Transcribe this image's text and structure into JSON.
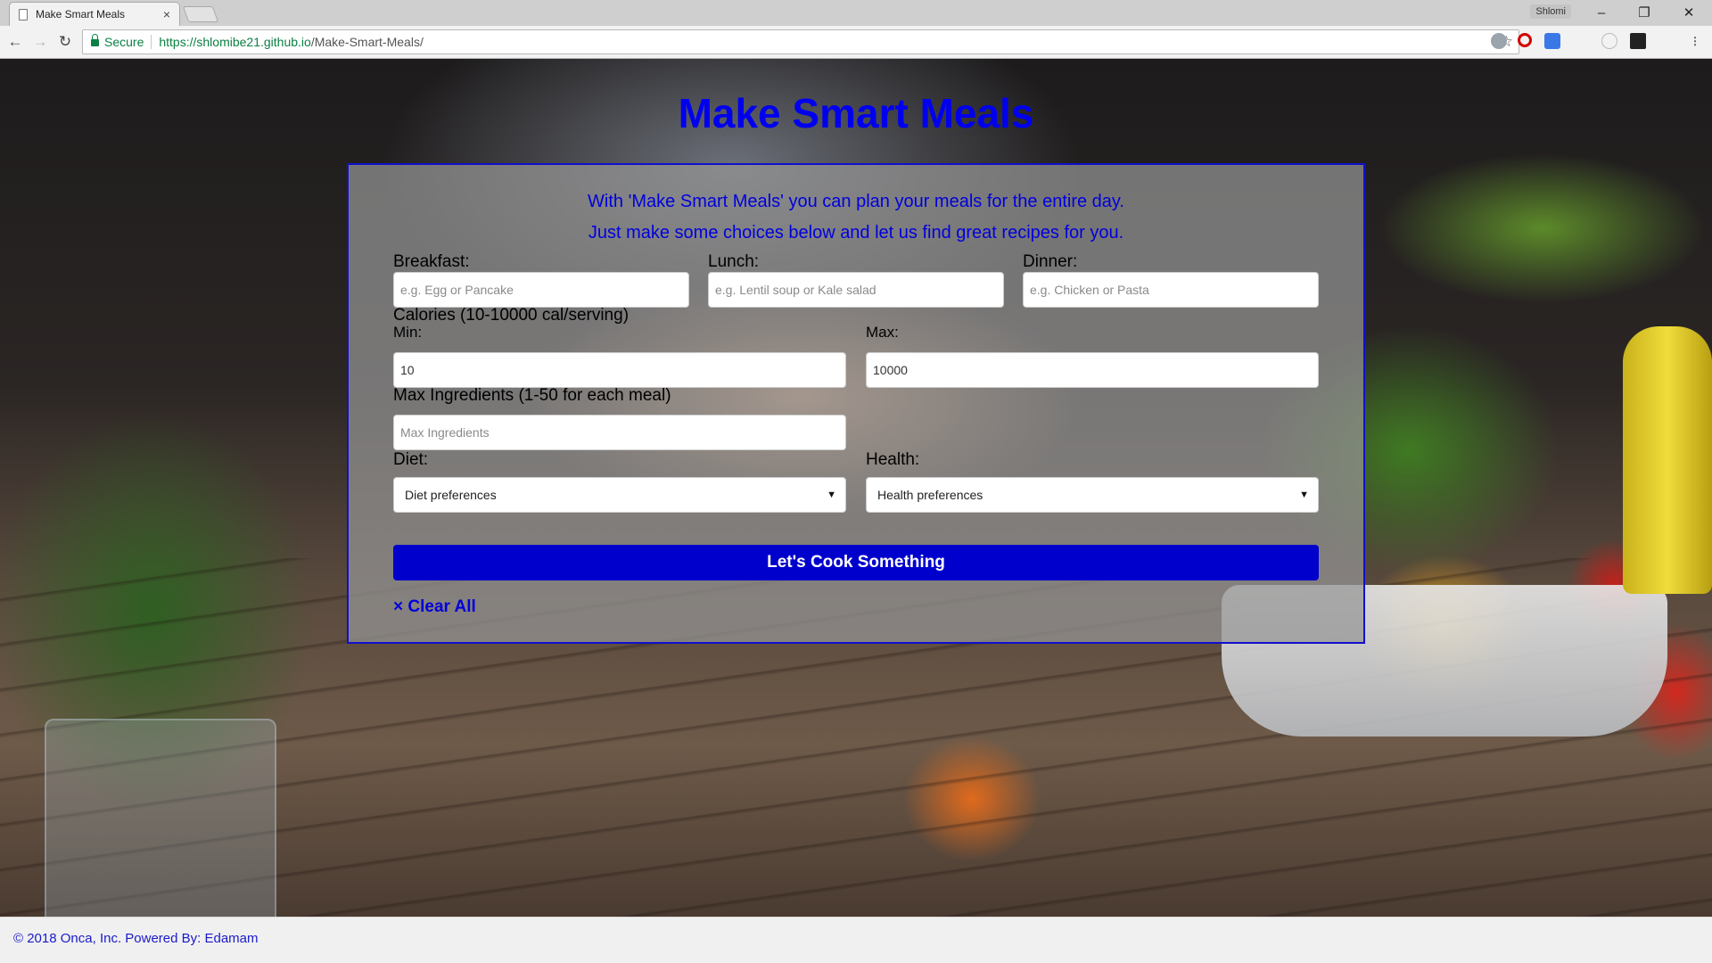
{
  "browser": {
    "tab_title": "Make Smart Meals",
    "tab_close": "×",
    "profile": "Shlomi",
    "window_controls": {
      "minimize": "–",
      "maximize": "❐",
      "close": "✕"
    },
    "nav": {
      "back": "←",
      "forward": "→",
      "reload": "↻"
    },
    "secure_label": "Secure",
    "url_host": "https://shlomibe21.github.io",
    "url_path": "/Make-Smart-Meals/",
    "bookmark_star": "☆"
  },
  "page": {
    "title": "Make Smart Meals",
    "intro_line1": "With 'Make Smart Meals' you can plan your meals for the entire day.",
    "intro_line2": "Just make some choices below and let us find great recipes for you.",
    "meals": {
      "breakfast": {
        "label": "Breakfast:",
        "placeholder": "e.g. Egg or Pancake",
        "value": ""
      },
      "lunch": {
        "label": "Lunch:",
        "placeholder": "e.g. Lentil soup or Kale salad",
        "value": ""
      },
      "dinner": {
        "label": "Dinner:",
        "placeholder": "e.g. Chicken or Pasta",
        "value": ""
      }
    },
    "calories": {
      "label": "Calories (10-10000 cal/serving)",
      "min_label": "Min:",
      "min_value": "10",
      "max_label": "Max:",
      "max_value": "10000"
    },
    "max_ingredients": {
      "label": "Max Ingredients (1-50 for each meal)",
      "placeholder": "Max Ingredients",
      "value": ""
    },
    "diet": {
      "label": "Diet:",
      "selected": "Diet preferences"
    },
    "health": {
      "label": "Health:",
      "selected": "Health preferences"
    },
    "caret": "▼",
    "submit_label": "Let's Cook Something",
    "clear_label": "× Clear All"
  },
  "footer": {
    "text": "© 2018 Onca, Inc. Powered By: Edamam"
  },
  "colors": {
    "title": "#0000ee",
    "button": "#0000cc",
    "link": "#0000dd",
    "secure": "#0b8043"
  },
  "icons": [
    "page-icon",
    "lock-icon",
    "star-icon",
    "back-icon",
    "forward-icon",
    "reload-icon",
    "caret-down-icon"
  ]
}
